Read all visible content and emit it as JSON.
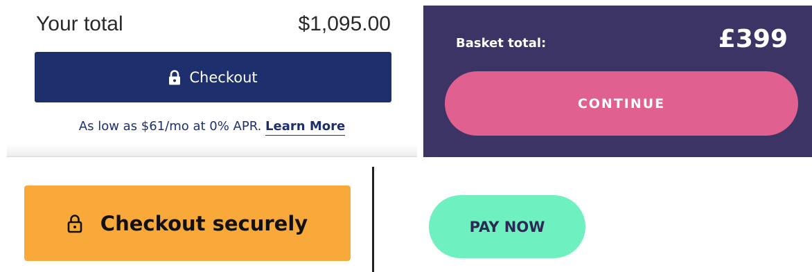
{
  "cart_panel": {
    "total_label": "Your total",
    "total_amount": "$1,095.00",
    "checkout_label": "Checkout",
    "apr_text": "As low as $61/mo at 0% APR.",
    "learn_more_label": "Learn More",
    "colors": {
      "button": "#1e2f6e",
      "text": "#2a2a2a"
    }
  },
  "basket_panel": {
    "total_label": "Basket total:",
    "total_amount": "£399",
    "continue_label": "CONTINUE",
    "colors": {
      "background": "#3d3466",
      "button": "#e0608f"
    }
  },
  "secure_panel": {
    "checkout_label": "Checkout securely",
    "icon": "lock-icon",
    "colors": {
      "button": "#f8a93a"
    }
  },
  "pay_panel": {
    "pay_label": "PAY NOW",
    "colors": {
      "button": "#6ff0c0",
      "text": "#2c2a54"
    }
  }
}
